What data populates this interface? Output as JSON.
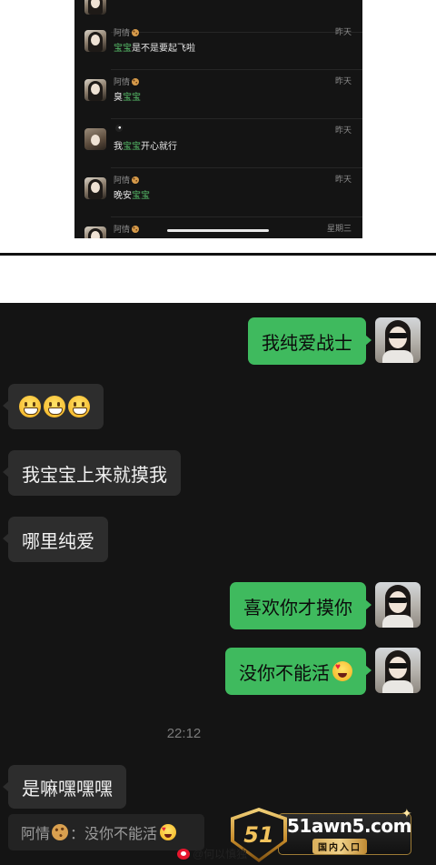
{
  "comments": [
    {
      "name": "阿情",
      "badge": "cookie-icon",
      "before": "",
      "highlight": "宝宝",
      "after": "是不是要起飞啦",
      "time": "昨天",
      "avatar": "woman"
    },
    {
      "name": "阿情",
      "badge": "cookie-icon",
      "before": "臭",
      "highlight": "宝宝",
      "after": "",
      "time": "昨天",
      "avatar": "woman"
    },
    {
      "name": "",
      "badge": "8-ball-icon",
      "before": "我",
      "highlight": "宝宝",
      "after": "开心就行",
      "time": "昨天",
      "avatar": "man"
    },
    {
      "name": "阿情",
      "badge": "cookie-icon",
      "before": "晚安",
      "highlight": "宝宝",
      "after": "",
      "time": "昨天",
      "avatar": "woman"
    },
    {
      "name": "阿情",
      "badge": "cookie-icon",
      "before": "",
      "highlight": "",
      "after": "",
      "time": "星期三",
      "avatar": "woman"
    }
  ],
  "chat": {
    "messages": [
      {
        "dir": "out",
        "text": "我纯爱战士"
      },
      {
        "dir": "in",
        "text": "",
        "emoji": "grinning-face-icon x3"
      },
      {
        "dir": "in",
        "text": "我宝宝上来就摸我"
      },
      {
        "dir": "in",
        "text": "哪里纯爱"
      },
      {
        "dir": "out",
        "text": "喜欢你才摸你"
      },
      {
        "dir": "out",
        "text": "没你不能活",
        "emoji": "heart-eyes-icon"
      },
      {
        "dir": "in",
        "text": "是嘛嘿嘿嘿"
      }
    ],
    "time": "22:12",
    "quote": {
      "name": "阿情",
      "sep": "：",
      "text": "没你不能活"
    }
  },
  "watermark": {
    "logo_number": "51",
    "domain": "51awn5.com",
    "tag": "国内入口",
    "weibo": "@何以慎独"
  },
  "colors": {
    "accent_green": "#3fba5e",
    "highlight_green": "#57be6a",
    "dark_bg": "#141414"
  }
}
